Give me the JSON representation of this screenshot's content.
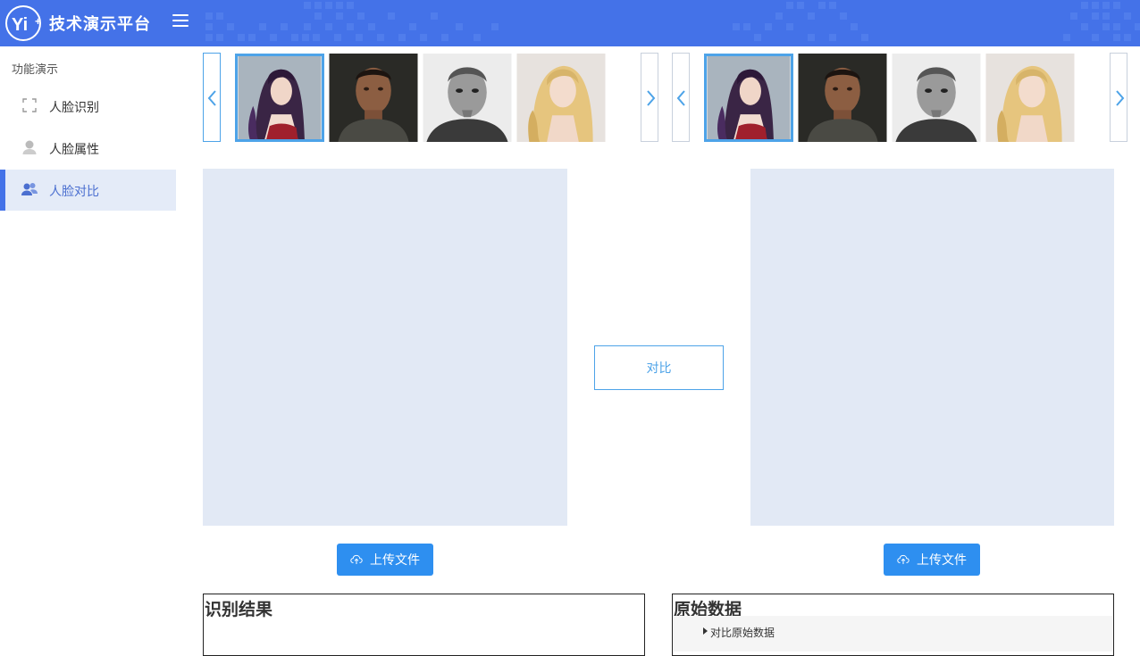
{
  "header": {
    "logo_text": "Yi+",
    "brand": "技术演示平台",
    "color": "#4472e8"
  },
  "sidebar": {
    "heading": "功能演示",
    "items": [
      {
        "label": "人脸识别",
        "icon": "face-scan-icon",
        "active": false
      },
      {
        "label": "人脸属性",
        "icon": "person-icon",
        "active": false
      },
      {
        "label": "人脸对比",
        "icon": "users-icon",
        "active": true
      }
    ]
  },
  "carousel_left": {
    "images": [
      "woman-dark-hair-photo",
      "man-dark-skin-photo",
      "man-grey-portrait-photo",
      "woman-blonde-photo"
    ],
    "selected_index": 0
  },
  "carousel_right": {
    "images": [
      "woman-dark-hair-photo",
      "man-dark-skin-photo",
      "man-grey-portrait-photo",
      "woman-blonde-photo"
    ],
    "selected_index": 0
  },
  "compare": {
    "label": "对比"
  },
  "upload": {
    "left_label": "上传文件",
    "right_label": "上传文件"
  },
  "results": {
    "recognition_title": "识别结果",
    "raw_title": "原始数据",
    "raw_toggle_label": "对比原始数据"
  },
  "colors": {
    "accent": "#4da3e8",
    "primary_button": "#2e8ff0",
    "panel_bg": "#e2e9f5"
  }
}
